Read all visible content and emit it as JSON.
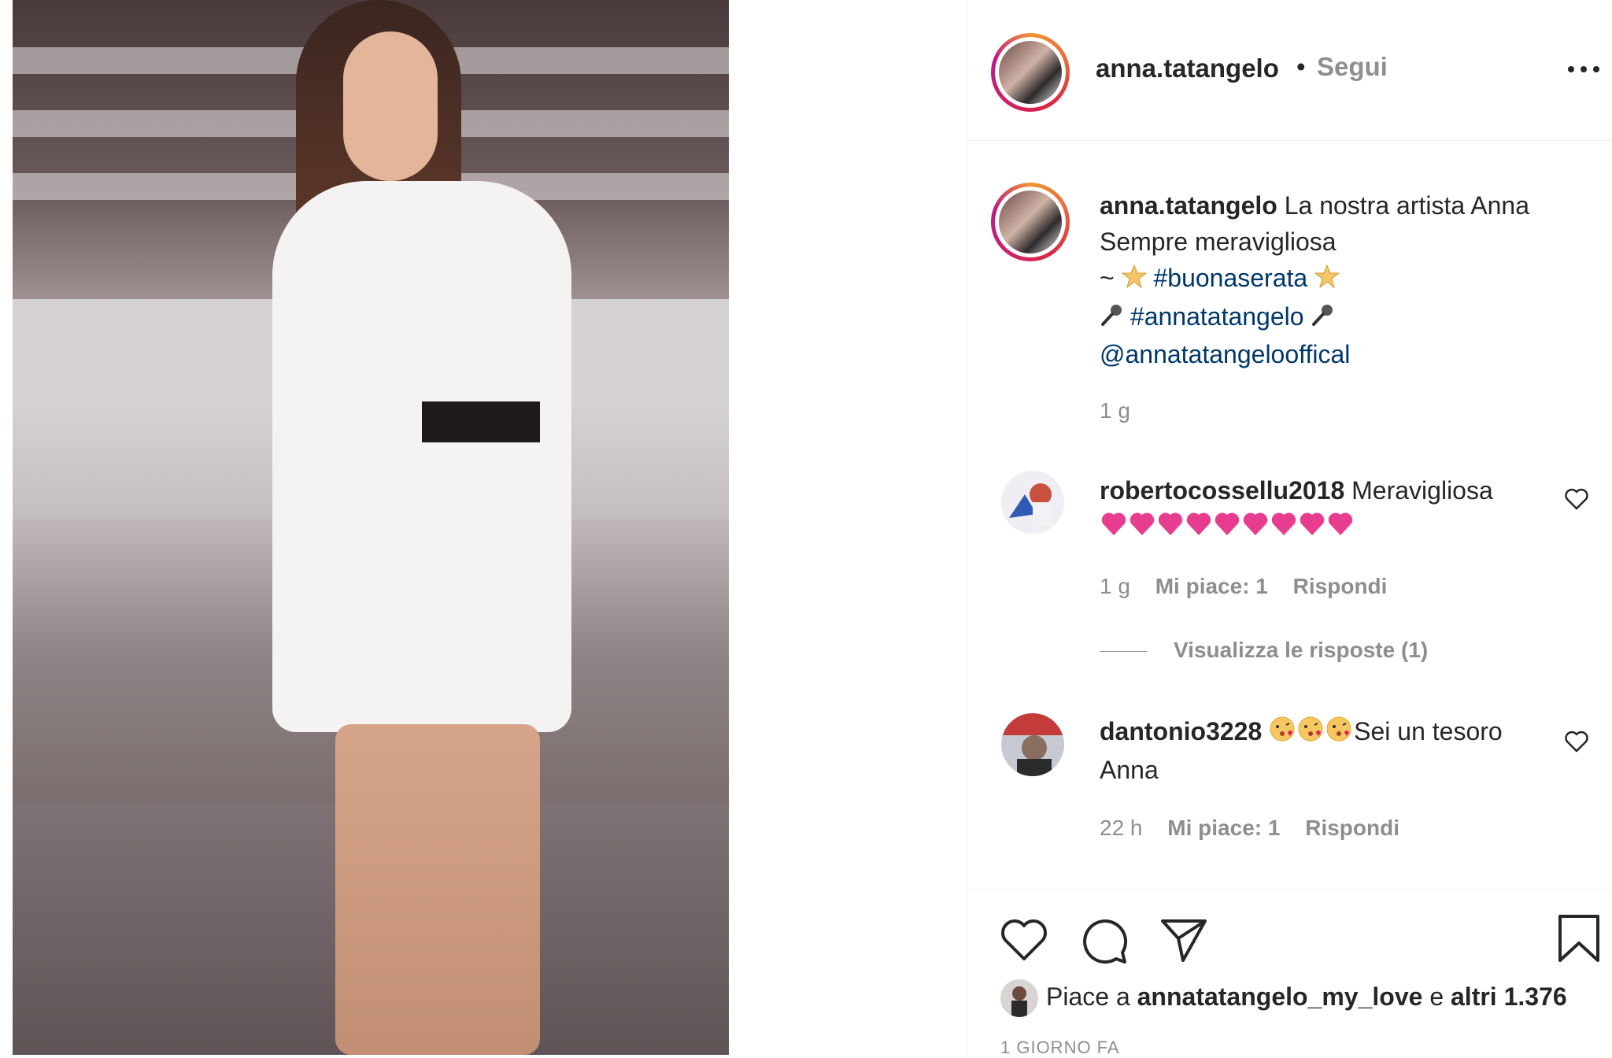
{
  "post": {
    "username": "anna.tatangelo",
    "dot": "•",
    "follow_label": "Segui",
    "caption": {
      "username": "anna.tatangelo",
      "line1_text": "La nostra artista Anna",
      "line2_text": "Sempre meravigliosa",
      "line3_prefix": "~",
      "hashtag1": "#buonaserata",
      "hashtag2": "#annatatangelo",
      "mention": "@annatatangelooffical",
      "time": "1 g"
    },
    "comments": [
      {
        "username": "robertocossellu2018",
        "text": "Meravigliosa",
        "emoji_hearts_count": 9,
        "time": "1 g",
        "likes": "Mi piace: 1",
        "reply_label": "Rispondi"
      },
      {
        "username": "dantonio3228",
        "text": "Sei un tesoro",
        "text_line2": "Anna",
        "time": "22 h",
        "likes": "Mi piace: 1",
        "reply_label": "Rispondi"
      }
    ],
    "view_replies": "Visualizza le risposte (1)",
    "likes_prefix": "Piace a",
    "likes_user": "annatatangelo_my_love",
    "likes_connector": "e",
    "likes_others": "altri 1.376",
    "date": "1 GIORNO FA"
  },
  "icons": [
    "more-icon",
    "heart-icon",
    "comment-icon",
    "share-icon",
    "bookmark-icon",
    "comment-like-icon",
    "star-emoji",
    "microphone-emoji",
    "sparkling-heart-emoji",
    "kissing-face-emoji"
  ],
  "colors": {
    "link": "#00376b",
    "muted": "#8e8e8e",
    "text": "#262626",
    "heart": "#e0245e"
  }
}
